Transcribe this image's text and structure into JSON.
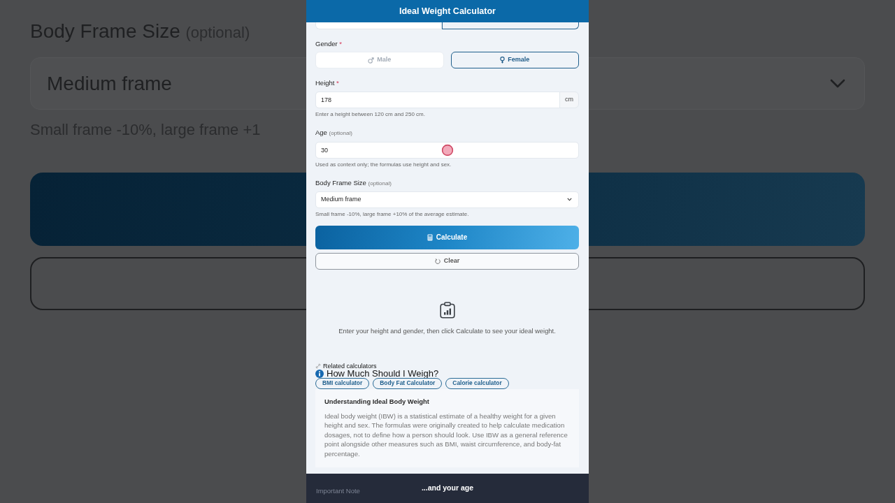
{
  "backdrop": {
    "frame_label": "Body Frame Size",
    "frame_label_note": "(optional)",
    "frame_select": "Medium frame",
    "frame_help": "Small frame -10%, large frame +1"
  },
  "header": {
    "title": "Ideal Weight Calculator"
  },
  "unit_toggle": [
    {
      "selected": false
    },
    {
      "selected": true
    }
  ],
  "gender": {
    "label": "Gender",
    "required_mark": "*",
    "options": [
      {
        "label": "Male",
        "selected": false
      },
      {
        "label": "Female",
        "selected": true
      }
    ]
  },
  "height": {
    "label": "Height",
    "required_mark": "*",
    "value": "178",
    "unit": "cm",
    "help": "Enter a height between 120 cm and 250 cm."
  },
  "age": {
    "label": "Age",
    "note": "(optional)",
    "value": "30",
    "help": "Used as context only; the formulas use height and sex."
  },
  "frame_size": {
    "label": "Body Frame Size",
    "note": "(optional)",
    "value": "Medium frame",
    "help": "Small frame -10%, large frame +10% of the average estimate."
  },
  "buttons": [
    {
      "kind": "primary",
      "label": "Calculate"
    },
    {
      "kind": "secondary",
      "label": "Clear"
    }
  ],
  "empty_state": {
    "message": "Enter your height and gender, then click Calculate to see your ideal weight."
  },
  "related": {
    "title": "Related calculators",
    "links": [
      "BMI calculator",
      "Body Fat Calculator",
      "Calorie calculator"
    ]
  },
  "section_heading": "How Much Should I Weigh?",
  "info_card": {
    "title": "Understanding Ideal Body Weight",
    "body": "Ideal body weight (IBW) is a statistical estimate of a healthy weight for a given height and sex. The formulas were originally created to help calculate medication dosages, not to define how a person should look. Use IBW as a general reference point alongside other measures such as BMI, waist circumference, and body-fat percentage."
  },
  "next_heading": "Important Note",
  "caption": "...and your age"
}
